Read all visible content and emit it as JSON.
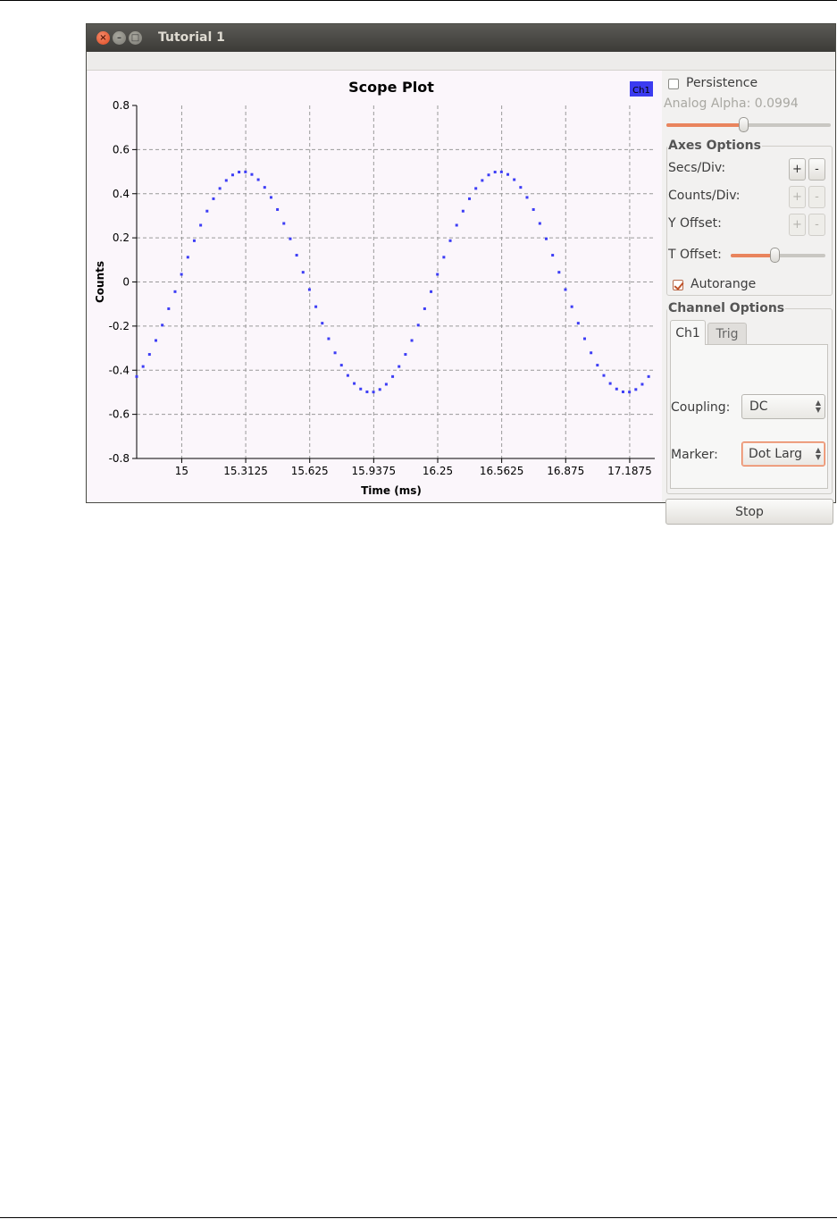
{
  "window": {
    "title": "Tutorial 1"
  },
  "plot": {
    "title": "Scope Plot",
    "legend_label": "Ch1",
    "legend_color": "#3b3bf0",
    "marker_color": "#3d3df5",
    "background": "#fbf6fb"
  },
  "chart_data": {
    "type": "scatter",
    "title": "Scope Plot",
    "xlabel": "Time (ms)",
    "ylabel": "Counts",
    "xlim": [
      14.78,
      17.31
    ],
    "ylim": [
      -0.8,
      0.8
    ],
    "x_ticks": [
      15,
      15.3125,
      15.625,
      15.9375,
      16.25,
      16.5625,
      16.875,
      17.1875
    ],
    "x_tick_labels": [
      "15",
      "15.3125",
      "15.625",
      "15.9375",
      "16.25",
      "16.5625",
      "16.875",
      "17.1875"
    ],
    "y_ticks": [
      -0.8,
      -0.6,
      -0.4,
      -0.2,
      0,
      0.2,
      0.4,
      0.6,
      0.8
    ],
    "y_tick_labels": [
      "-0.8",
      "-0.6",
      "-0.4",
      "-0.2",
      "0",
      "0.2",
      "0.4",
      "0.6",
      "0.8"
    ],
    "grid": true,
    "legend": "top-right",
    "series": [
      {
        "name": "Ch1",
        "amplitude": 0.5,
        "zero_crossing_ms": 14.985,
        "period_ms": 1.25,
        "sample_interval_ms": 0.03125,
        "x_start": 14.78,
        "x_end": 17.31
      }
    ]
  },
  "panel": {
    "persistence_label": "Persistence",
    "persistence_checked": false,
    "analog_alpha_label": "Analog Alpha: 0.0994",
    "analog_alpha_value": 0.47,
    "axes_options": {
      "title": "Axes Options",
      "secs_div_label": "Secs/Div:",
      "counts_div_label": "Counts/Div:",
      "y_offset_label": "Y Offset:",
      "t_offset_label": "T Offset:",
      "t_offset_value": 0.46,
      "plus": "+",
      "minus": "-",
      "autorange_label": "Autorange",
      "autorange_checked": true
    },
    "channel_options": {
      "title": "Channel Options",
      "tabs": [
        {
          "label": "Ch1",
          "active": true
        },
        {
          "label": "Trig",
          "active": false
        }
      ],
      "coupling_label": "Coupling:",
      "coupling_value": "DC",
      "marker_label": "Marker:",
      "marker_value": "Dot Larg"
    },
    "stop_label": "Stop"
  },
  "colors": {
    "accent": "#e9845d",
    "titlebar": "#3c3b37",
    "panel_bg": "#f2f1f0"
  }
}
